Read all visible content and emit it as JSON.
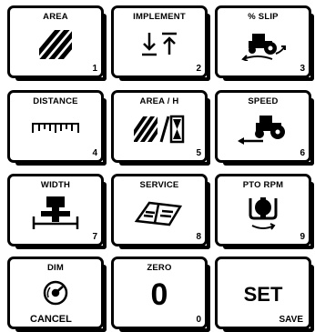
{
  "keys": [
    {
      "label": "AREA",
      "number": "1",
      "icon": "area-hatch-icon"
    },
    {
      "label": "IMPLEMENT",
      "number": "2",
      "icon": "implement-up-down-icon"
    },
    {
      "label": "% SLIP",
      "number": "3",
      "icon": "tractor-slip-icon"
    },
    {
      "label": "DISTANCE",
      "number": "4",
      "icon": "ruler-icon"
    },
    {
      "label": "AREA / H",
      "number": "5",
      "icon": "area-per-hour-icon"
    },
    {
      "label": "SPEED",
      "number": "6",
      "icon": "tractor-speed-icon"
    },
    {
      "label": "WIDTH",
      "number": "7",
      "icon": "implement-width-icon"
    },
    {
      "label": "SERVICE",
      "number": "8",
      "icon": "service-book-icon"
    },
    {
      "label": "PTO RPM",
      "number": "9",
      "icon": "pto-shaft-icon"
    },
    {
      "label": "DIM",
      "sub_label": "CANCEL",
      "icon": "dimmer-dial-icon"
    },
    {
      "label": "ZERO",
      "big": "0",
      "number": "0"
    },
    {
      "big": "SET",
      "sub_label": "SAVE"
    }
  ]
}
